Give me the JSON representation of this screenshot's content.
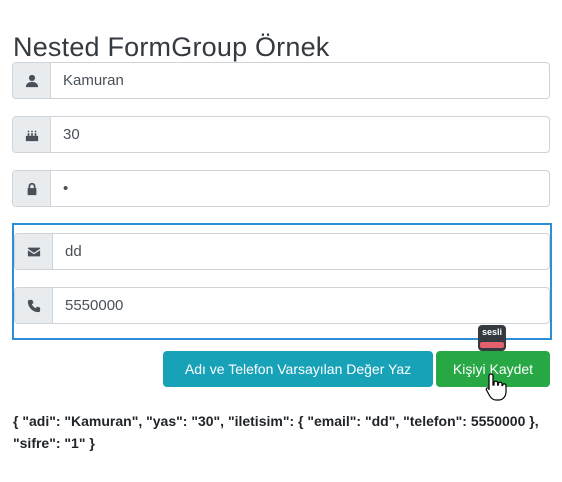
{
  "page": {
    "title": "Nested FormGroup Örnek"
  },
  "form": {
    "adi": {
      "value": "Kamuran",
      "icon": "user-icon"
    },
    "yas": {
      "value": "30",
      "icon": "birthday-cake-icon"
    },
    "sifre": {
      "value": "•",
      "icon": "lock-icon"
    },
    "iletisim": {
      "email": {
        "value": "dd",
        "icon": "envelope-icon"
      },
      "telefon": {
        "value": "5550000",
        "icon": "phone-icon"
      }
    }
  },
  "actions": {
    "default_label": "Adı ve Telefon Varsayılan Değer Yaz",
    "save_label": "Kişiyi Kaydet"
  },
  "tooltip": {
    "text": "sesli"
  },
  "output": {
    "json_text": "{ \"adi\": \"Kamuran\", \"yas\": \"30\", \"iletisim\": { \"email\": \"dd\", \"telefon\": 5550000 }, \"sifre\": \"1\" }"
  },
  "colors": {
    "info": "#17a2b8",
    "success": "#28a745",
    "focus_border": "#2a8fd6"
  }
}
